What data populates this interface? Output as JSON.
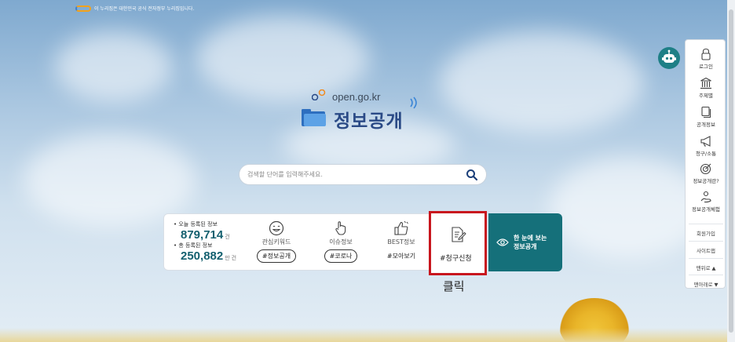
{
  "gov_banner": {
    "text": "이 누리집은 대한민국 공식 전자정부 누리집입니다."
  },
  "logo": {
    "top_text": "open.go.kr",
    "main_text": "정보공개"
  },
  "search": {
    "placeholder": "검색할 단어를 입력해주세요."
  },
  "stats": {
    "today_label": "• 오늘 등록된 정보",
    "today_value": "879,714",
    "today_unit": "건",
    "total_label": "• 총 등록된 정보",
    "total_value": "250,882",
    "total_unit": "만 건"
  },
  "features": [
    {
      "label": "관심키워드",
      "tag": "#정보공개",
      "icon": "smile-icon"
    },
    {
      "label": "이슈정보",
      "tag": "#코로나",
      "icon": "pointer-hand-icon"
    },
    {
      "label": "BEST정보",
      "tag": "#모아보기",
      "icon": "thumbs-up-icon"
    },
    {
      "label": "",
      "tag": "#청구신청",
      "icon": "document-edit-icon"
    }
  ],
  "teal_box": {
    "line1": "한 눈에 보는",
    "line2": "정보공개"
  },
  "click_note": "클릭",
  "quick_menu": {
    "items": [
      {
        "label": "로그인",
        "icon": "lock-icon"
      },
      {
        "label": "주제별",
        "icon": "building-icon"
      },
      {
        "label": "공개정보",
        "icon": "copy-icon"
      },
      {
        "label": "청구/소통",
        "icon": "megaphone-icon"
      },
      {
        "label": "정보공개란?",
        "icon": "target-icon"
      },
      {
        "label": "정보공개체험",
        "icon": "person-hand-icon"
      }
    ],
    "join": "회원가입",
    "sitemap": "사이트맵",
    "top": "맨위로 ▲",
    "bottom": "맨아래로 ▼"
  },
  "colors": {
    "teal": "#15707a",
    "highlight_red": "#c8161e",
    "brand_blue": "#2a4a86"
  }
}
